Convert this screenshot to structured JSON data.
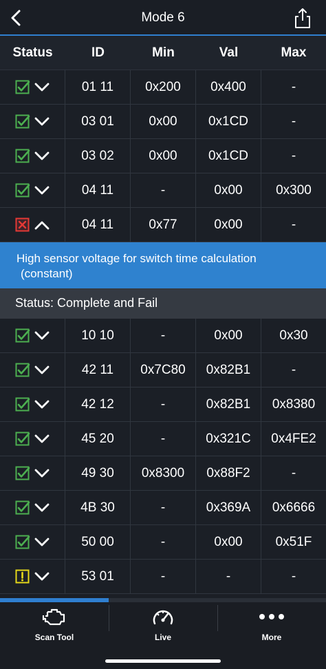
{
  "header": {
    "title": "Mode 6"
  },
  "columns": [
    "Status",
    "ID",
    "Min",
    "Val",
    "Max"
  ],
  "rows_top": [
    {
      "status": "pass",
      "expanded": false,
      "id": "01 11",
      "min": "0x200",
      "val": "0x400",
      "max": "-"
    },
    {
      "status": "pass",
      "expanded": false,
      "id": "03 01",
      "min": "0x00",
      "val": "0x1CD",
      "max": "-"
    },
    {
      "status": "pass",
      "expanded": false,
      "id": "03 02",
      "min": "0x00",
      "val": "0x1CD",
      "max": "-"
    },
    {
      "status": "pass",
      "expanded": false,
      "id": "04 11",
      "min": "-",
      "val": "0x00",
      "max": "0x300"
    },
    {
      "status": "fail",
      "expanded": true,
      "id": "04 11",
      "min": "0x77",
      "val": "0x00",
      "max": "-"
    }
  ],
  "detail": {
    "description_line1": "High sensor voltage for switch time calculation",
    "description_line2": "(constant)",
    "status_text": "Status: Complete and Fail"
  },
  "rows_bottom": [
    {
      "status": "pass",
      "expanded": false,
      "id": "10 10",
      "min": "-",
      "val": "0x00",
      "max": "0x30"
    },
    {
      "status": "pass",
      "expanded": false,
      "id": "42 11",
      "min": "0x7C80",
      "val": "0x82B1",
      "max": "-"
    },
    {
      "status": "pass",
      "expanded": false,
      "id": "42 12",
      "min": "-",
      "val": "0x82B1",
      "max": "0x8380"
    },
    {
      "status": "pass",
      "expanded": false,
      "id": "45 20",
      "min": "-",
      "val": "0x321C",
      "max": "0x4FE2"
    },
    {
      "status": "pass",
      "expanded": false,
      "id": "49 30",
      "min": "0x8300",
      "val": "0x88F2",
      "max": "-"
    },
    {
      "status": "pass",
      "expanded": false,
      "id": "4B 30",
      "min": "-",
      "val": "0x369A",
      "max": "0x6666"
    },
    {
      "status": "pass",
      "expanded": false,
      "id": "50 00",
      "min": "-",
      "val": "0x00",
      "max": "0x51F"
    },
    {
      "status": "warning",
      "expanded": false,
      "id": "53 01",
      "min": "-",
      "val": "-",
      "max": "-"
    }
  ],
  "progress": 0.333,
  "tabs": [
    {
      "label": "Scan Tool",
      "icon": "engine-icon"
    },
    {
      "label": "Live",
      "icon": "gauge-icon"
    },
    {
      "label": "More",
      "icon": "more-dots-icon"
    }
  ],
  "colors": {
    "accent": "#2f7fd0",
    "pass": "#4caf50",
    "fail": "#e53935",
    "warning": "#e6d81a"
  }
}
